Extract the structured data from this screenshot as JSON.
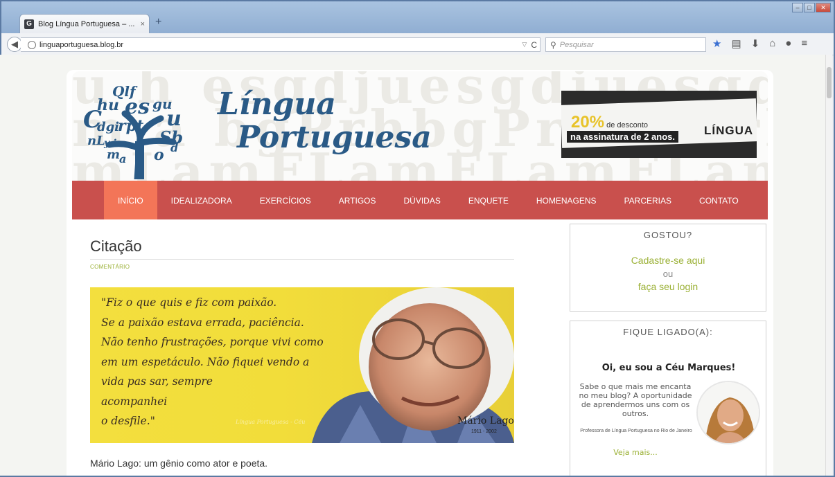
{
  "browser": {
    "tab_title": "Blog Língua Portuguesa – ...",
    "tab_favicon": "G",
    "tab_close": "×",
    "new_tab": "+",
    "url": "linguaportuguesa.blog.br",
    "search_placeholder": "Pesquisar"
  },
  "header": {
    "logo_line1": "Língua",
    "logo_line2": "Portuguesa",
    "bg_letters": "u h  e s g d j u e s g d j u e s g d j u e s g d j u",
    "ad": {
      "percent": "20%",
      "percent_suffix": " de desconto",
      "subline": "na assinatura de 2 anos.",
      "brand": "LÍNGUA"
    }
  },
  "nav": {
    "items": [
      "INÍCIO",
      "IDEALIZADORA",
      "EXERCÍCIOS",
      "ARTIGOS",
      "DÚVIDAS",
      "ENQUETE",
      "HOMENAGENS",
      "PARCERIAS",
      "CONTATO"
    ]
  },
  "post": {
    "title": "Citação",
    "category": "COMENTÁRIO",
    "quote_lines": [
      "\"Fiz o que quis e fiz com paixão.",
      "Se a paixão estava errada, paciência.",
      "Não tenho frustrações, porque vivi como",
      "em um espetáculo. Não fiquei vendo a",
      "vida pas sar, sempre",
      "acompanhei",
      "o desfile.\""
    ],
    "image_credit": "Língua Portuguesa - Céu",
    "image_author": "Mário Lago",
    "image_years": "1911 - 2002",
    "text": "Mário Lago: um gênio como ator e poeta."
  },
  "sidebar": {
    "gostou": {
      "title": "GOSTOU?",
      "link1": "Cadastre-se aqui",
      "or": "ou",
      "link2": "faça seu login"
    },
    "fique": {
      "title": "FIQUE LIGADO(A):",
      "hello": "Oi, eu sou a Céu Marques!",
      "about": "Sabe o que mais me encanta no meu blog? A oportunidade de aprendermos uns com os outros.",
      "role": "Professora de Língua Portuguesa no Rio de Janeiro",
      "more": "Veja mais..."
    }
  },
  "colors": {
    "nav_bg": "#c9504d",
    "nav_active": "#f37558",
    "logo_blue": "#2a5a86",
    "link_green": "#9ab034"
  }
}
